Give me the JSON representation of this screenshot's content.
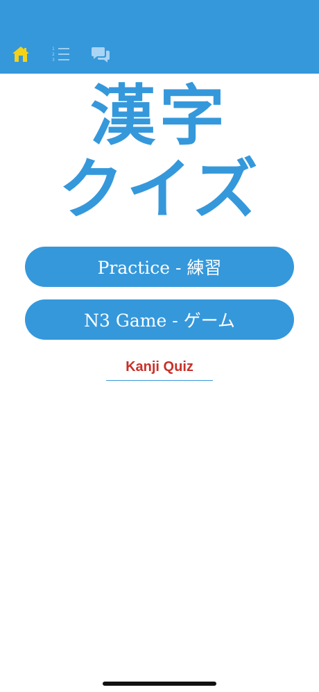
{
  "nav": {
    "icons": [
      "home-icon",
      "list-icon",
      "chat-icon"
    ],
    "home_color": "#f4d21a",
    "icon_color": "#a9d4f3"
  },
  "title": {
    "kanji": "漢字",
    "kana": "クイズ"
  },
  "buttons": {
    "practice_label": "Practice - 練習",
    "game_label": "N3 Game - ゲーム"
  },
  "quiz_label": "Kanji Quiz",
  "colors": {
    "primary": "#3598db",
    "accent_text": "#c8312a",
    "background": "#ffffff"
  }
}
